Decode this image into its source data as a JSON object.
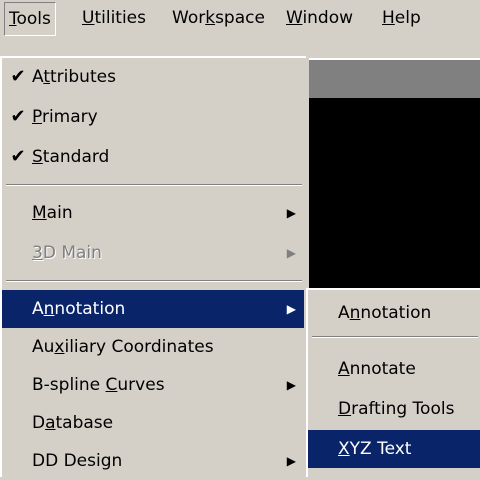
{
  "menubar": {
    "items": [
      {
        "pre": "",
        "u": "T",
        "post": "ools"
      },
      {
        "pre": "",
        "u": "U",
        "post": "tilities"
      },
      {
        "pre": "Wor",
        "u": "k",
        "post": "space"
      },
      {
        "pre": "",
        "u": "W",
        "post": "indow"
      },
      {
        "pre": "",
        "u": "H",
        "post": "elp"
      }
    ]
  },
  "tools_menu": {
    "items": [
      {
        "pre": "A",
        "u": "t",
        "post": "tributes",
        "checked": "✔"
      },
      {
        "pre": "",
        "u": "P",
        "post": "rimary",
        "checked": "✔"
      },
      {
        "pre": "",
        "u": "S",
        "post": "tandard",
        "checked": "✔"
      },
      {
        "pre": "",
        "u": "M",
        "post": "ain",
        "arrow": "▶"
      },
      {
        "pre": "",
        "u": "3",
        "post": "D Main",
        "arrow": "▶",
        "disabled": true
      },
      {
        "pre": "A",
        "u": "n",
        "post": "notation",
        "arrow": "▶",
        "highlighted": true
      },
      {
        "pre": "Au",
        "u": "x",
        "post": "iliary Coordinates"
      },
      {
        "pre": "B-spline ",
        "u": "C",
        "post": "urves",
        "arrow": "▶"
      },
      {
        "pre": "D",
        "u": "a",
        "post": "tabase"
      },
      {
        "pre": "DD Design",
        "u": "",
        "post": "",
        "arrow": "▶"
      }
    ]
  },
  "annotation_submenu": {
    "items": [
      {
        "pre": "A",
        "u": "n",
        "post": "notation"
      },
      {
        "pre": "",
        "u": "A",
        "post": "nnotate"
      },
      {
        "pre": "",
        "u": "D",
        "post": "rafting Tools"
      },
      {
        "pre": "",
        "u": "X",
        "post": "YZ Text",
        "highlighted": true
      }
    ]
  },
  "colors": {
    "menu_bg": "#d4d0c8",
    "highlight": "#0a246a",
    "highlight_text": "#ffffff",
    "disabled_text": "#808080",
    "workspace": "#000000"
  }
}
